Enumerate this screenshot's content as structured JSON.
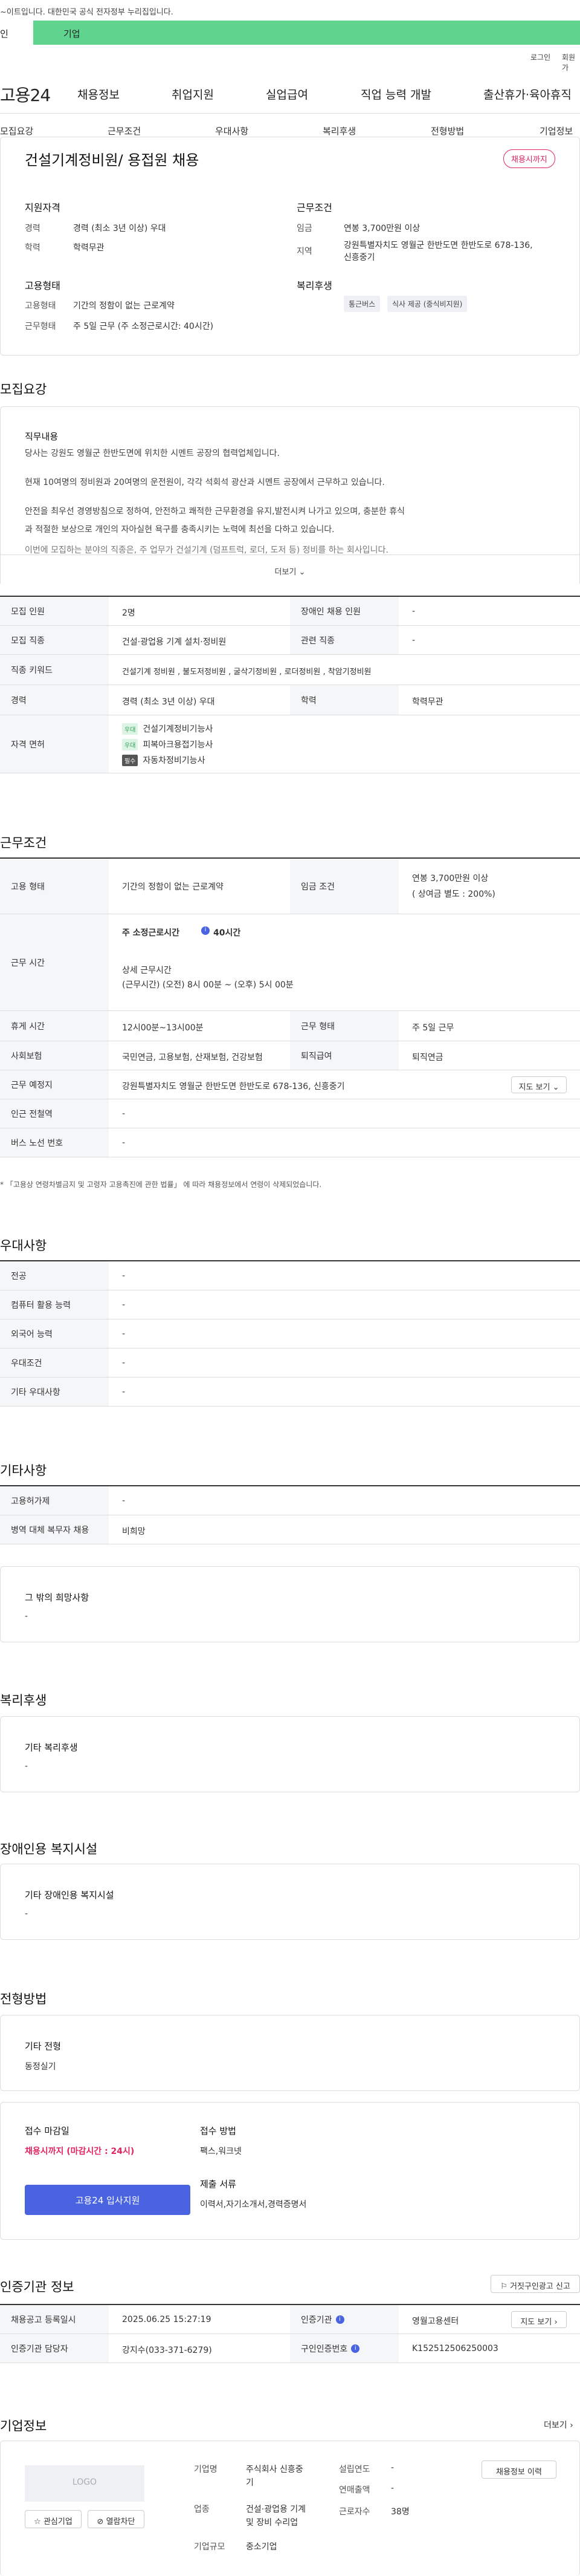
{
  "gov_notice": "~이트입니다. 대한민국 공식 전자정부 누리집입니다.",
  "site_tabs": {
    "personal": "인",
    "company": "기업"
  },
  "util": {
    "login": "로그인",
    "signup": "회원가"
  },
  "gnb": {
    "logo": "고용24",
    "items": [
      "채용정보",
      "취업지원",
      "실업급여",
      "직업 능력 개발",
      "출산휴가·육아휴직"
    ]
  },
  "subnav": [
    "모집요강",
    "근무조건",
    "우대사항",
    "복리후생",
    "전형방법",
    "기업정보"
  ],
  "summary": {
    "title": "건설기계정비원/ 용접원 채용",
    "status_badge": "채용시까지",
    "qualification": {
      "heading": "지원자격",
      "career_label": "경력",
      "career_value": "경력 (최소 3년 이상) 우대",
      "edu_label": "학력",
      "edu_value": "학력무관"
    },
    "conditions": {
      "heading": "근무조건",
      "wage_label": "임금",
      "wage_value": "연봉 3,700만원 이상",
      "location_label": "지역",
      "location_value_1": "강원특별자치도 영월군 한반도면 한반도로 678-136,",
      "location_value_2": "신흥중기"
    },
    "employment": {
      "heading": "고용형태",
      "type_label": "고용형태",
      "type_value": "기간의 정함이 없는 근로계약",
      "work_label": "근무형태",
      "work_value": "주 5일 근무 (주 소정근로시간: 40시간)"
    },
    "welfare": {
      "heading": "복리후생",
      "chips": [
        "통근버스",
        "식사 제공 (중식비지원)"
      ]
    }
  },
  "recruit": {
    "heading": "모집요강",
    "duty_heading": "직무내용",
    "duty_lines": [
      "당사는 강원도 영월군 한반도면에 위치한 시멘트 공장의 협력업체입니다.",
      "현재 10여명의 정비원과 20여명의 운전원이, 각각 석회석 광산과 시멘트 공장에서 근무하고 있습니다.",
      "안전을 최우선 경영방침으로 정하여, 안전하고 쾌적한 근무환경을 유지,발전시켜 나가고 있으며, 충분한 휴식",
      "과 적절한 보상으로 개인의 자아실현 욕구를 충족시키는 노력에 최선을 다하고 있습니다.",
      "이번에 모집하는 분야의 직종은, 주 업무가 건설기계 (덤프트럭, 로더, 도저 등) 정비를 하는 회사입니다."
    ],
    "more_label": "더보기",
    "rows": {
      "count_label": "모집 인원",
      "count_value": "2명",
      "disabled_label": "장애인 채용 인원",
      "disabled_value": "-",
      "job_label": "모집 직종",
      "job_value": "건설·광업용 기계 설치·정비원",
      "related_label": "관련 직종",
      "related_value": "-",
      "keyword_label": "직종 키워드",
      "keyword_value": "건설기계 정비원 , 불도저정비원 , 굴삭기정비원 , 로더정비원 , 착암기정비원",
      "career_label": "경력",
      "career_value": "경력 (최소 3년 이상) 우대",
      "edu_label": "학력",
      "edu_value": "학력무관",
      "license_label": "자격 면허",
      "licenses": [
        {
          "tag": "우대",
          "name": "건설기계정비기능사"
        },
        {
          "tag": "우대",
          "name": "피복아크용접기능사"
        },
        {
          "tag": "필수",
          "name": "자동차정비기능사"
        }
      ]
    }
  },
  "work": {
    "heading": "근무조건",
    "type_label": "고용 형태",
    "type_value": "기간의 정함이 없는 근로계약",
    "wage_label": "임금 조건",
    "wage_value_1": "연봉 3,700만원 이상",
    "wage_value_2": "( 상여금 별도 : 200%)",
    "hours_label": "근무 시간",
    "hours_weekly": "주 소정근로시간",
    "hours_weekly_value": "40시간",
    "hours_detail_label": "상세 근무시간",
    "hours_detail_value": "(근무시간) (오전) 8시 00분 ~ (오후) 5시 00분",
    "break_label": "휴게 시간",
    "break_value": "12시00분~13시00분",
    "worktype_label": "근무 형태",
    "worktype_value": "주 5일 근무",
    "insurance_label": "사회보험",
    "insurance_value": "국민연금, 고용보험, 산재보험, 건강보험",
    "retire_label": "퇴직급여",
    "retire_value": "퇴직연금",
    "place_label": "근무 예정지",
    "place_value": "강원특별자치도 영월군 한반도면 한반도로 678-136, 신흥중기",
    "map_button": "지도 보기",
    "subway_label": "인근 전철역",
    "subway_value": "-",
    "bus_label": "버스 노선 번호",
    "bus_value": "-",
    "note": "* 「고용상 연령차별금지 및 고령자 고용촉진에 관한 법률」 에 따라 채용정보에서 연령이 삭제되었습니다."
  },
  "preference": {
    "heading": "우대사항",
    "rows": [
      {
        "label": "전공",
        "value": "-"
      },
      {
        "label": "컴퓨터 활용 능력",
        "value": "-"
      },
      {
        "label": "외국어 능력",
        "value": "-"
      },
      {
        "label": "우대조건",
        "value": "-"
      },
      {
        "label": "기타 우대사항",
        "value": "-"
      }
    ]
  },
  "etc": {
    "heading": "기타사항",
    "rows": [
      {
        "label": "고용허가제",
        "value": "-"
      },
      {
        "label": "병역 대체 복무자 채용",
        "value": "비희망"
      }
    ],
    "box_title": "그 밖의 희망사항",
    "box_value": "-"
  },
  "welfare": {
    "heading": "복리후생",
    "box_title": "기타 복리후생",
    "box_value": "-"
  },
  "disabled": {
    "heading": "장애인용 복지시설",
    "box_title": "기타 장애인용 복지시설",
    "box_value": "-"
  },
  "selection": {
    "heading": "전형방법",
    "box_title": "기타 전형",
    "box_value": "동정실기",
    "deadline_label": "접수 마감일",
    "deadline_value": "채용시까지 (마감시간 : 24시)",
    "method_label": "접수 방법",
    "method_value": "팩스,워크넷",
    "docs_label": "제출 서류",
    "docs_value": "이력서,자기소개서,경력증명서",
    "apply_button": "고용24 입사지원"
  },
  "agency": {
    "heading": "인증기관 정보",
    "report_button": "거짓구인광고 신고",
    "reg_label": "채용공고 등록일시",
    "reg_value": "2025.06.25 15:27:19",
    "org_label": "인증기관",
    "org_value": "영월고용센터",
    "map_button": "지도 보기",
    "manager_label": "인증기관 담당자",
    "manager_value": "강지수(033-371-6279)",
    "id_label": "구인인증번호",
    "id_value": "K152512506250003"
  },
  "company": {
    "heading": "기업정보",
    "more": "더보기",
    "logo_text": "LOGO",
    "fav_button": "관심기업",
    "block_button": "열람차단",
    "name_label": "기업명",
    "name_value_1": "주식회사 신흥중",
    "name_value_2": "기",
    "industry_label": "업종",
    "industry_value_1": "건설·광업용 기계",
    "industry_value_2": "및 장비 수리업",
    "size_label": "기업규모",
    "size_value": "중소기업",
    "founded_label": "설립연도",
    "founded_value": "-",
    "revenue_label": "연매출액",
    "revenue_value": "-",
    "staff_label": "근로자수",
    "staff_value": "38명",
    "history_button": "채용정보 이력"
  }
}
